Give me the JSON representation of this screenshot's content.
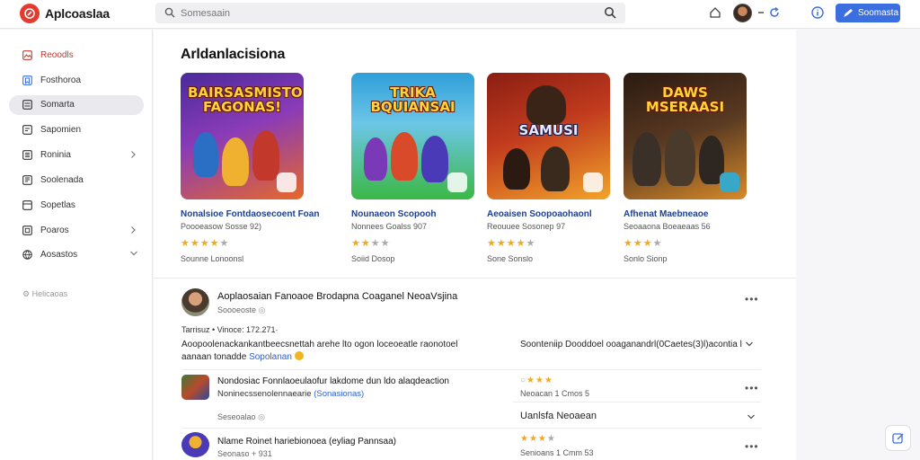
{
  "header": {
    "app_name": "Aplcoaslaa",
    "search_placeholder": "Somesaain",
    "primary_button": "Soomasta"
  },
  "sidebar": {
    "items": [
      {
        "label": "Reoodls",
        "icon": "image-icon",
        "chevron": false
      },
      {
        "label": "Fosthoroa",
        "icon": "bookmark-icon",
        "chevron": false
      },
      {
        "label": "Somarta",
        "icon": "grid-icon",
        "chevron": false,
        "active": true
      },
      {
        "label": "Sapomien",
        "icon": "file-icon",
        "chevron": false
      },
      {
        "label": "Roninia",
        "icon": "list-icon",
        "chevron": true
      },
      {
        "label": "Soolenada",
        "icon": "document-icon",
        "chevron": false
      },
      {
        "label": "Sopetlas",
        "icon": "card-icon",
        "chevron": false
      },
      {
        "label": "Poaros",
        "icon": "box-icon",
        "chevron": true
      },
      {
        "label": "Aosastos",
        "icon": "globe-icon",
        "chevron": true
      }
    ],
    "footer_note": "Helicaoas"
  },
  "main": {
    "section_title": "Arldanlacisiona",
    "games": [
      {
        "thumb_text": "BAIRSASMISTO FAGONAS!",
        "name": "Nonalsioe Fontdaosecoent Foan",
        "sub": "Poooeasow Sosse 92)",
        "rating": 4,
        "meta": "Sounne Lonoonsl",
        "palette": [
          "#7a3bb8",
          "#e6682a"
        ]
      },
      {
        "thumb_text": "TRIKA BQUIANSAI",
        "name": "Nounaeon Scopooh",
        "sub": "Nonnees Goalss 907",
        "rating": 3,
        "meta": "Soiid Dosop",
        "palette": [
          "#2f9fd8",
          "#3bb845"
        ]
      },
      {
        "thumb_text": "SAMUSI",
        "name": "Aeoaisen Soopoaohaonl",
        "sub": "Reouuee Sosonep 97",
        "rating": 4,
        "meta": "Sone Sonslo",
        "palette": [
          "#c23b1e",
          "#f2a42a"
        ]
      },
      {
        "thumb_text": "DAWS MSERAASI",
        "name": "Afhenat Maebneaoe",
        "sub": "Seoaaona Boeaeaas 56",
        "rating": 3,
        "meta": "Sonlo Sionp",
        "palette": [
          "#5a3a22",
          "#d88a2a"
        ]
      }
    ],
    "post": {
      "title": "Aoplaosaian Fanoaoe Brodapna Coaganel NeoaVsjina",
      "sub": "Soooeoste",
      "date": "Tarrisuz • Vinoce: 172.271·",
      "body_text": "Aoopoolenackankantbeecsnettah arehe  lto ogon loceoeatle raonotoel aanaan tonadde",
      "body_link": "Sopolanan",
      "right_text": "Soonteniip Dooddoel ooaganandrl(0Caetes(3)l)acontia l"
    },
    "rows": [
      {
        "title": "Nondosiac Fonnlaoeulaofur lakdome dun ldo alaqdeaction",
        "desc": "Noninecssenolennaearie",
        "desc_link": "(Sonasionas)",
        "meta": "Seseoalao",
        "stars": 3,
        "count": "Neoacan 1 Cmos 5",
        "select": "Uanlsfa Neoaean"
      },
      {
        "title": "Nlame Roinet hariebionoea  (eyliag Pannsaa)",
        "meta": "Seonaso + 931",
        "stars": 3,
        "count": "Senioans 1 Cmm 53"
      }
    ]
  },
  "colors": {
    "accent": "#3b6fe0",
    "brand": "#e33b2e",
    "link": "#2d5fcc",
    "star": "#f0a920"
  }
}
